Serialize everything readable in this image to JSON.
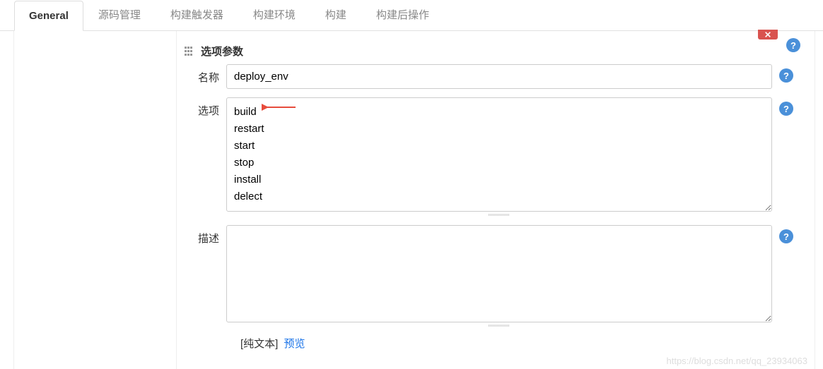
{
  "tabs": {
    "general": "General",
    "scm": "源码管理",
    "triggers": "构建触发器",
    "env": "构建环境",
    "build": "构建",
    "postbuild": "构建后操作"
  },
  "section": {
    "title": "选项参数"
  },
  "fields": {
    "name_label": "名称",
    "name_value": "deploy_env",
    "options_label": "选项",
    "options_value": "build\nrestart\nstart\nstop\ninstall\ndelect",
    "description_label": "描述",
    "description_value": ""
  },
  "format": {
    "plaintext": "[纯文本]",
    "preview": "预览"
  },
  "watermark": "https://blog.csdn.net/qq_23934063"
}
